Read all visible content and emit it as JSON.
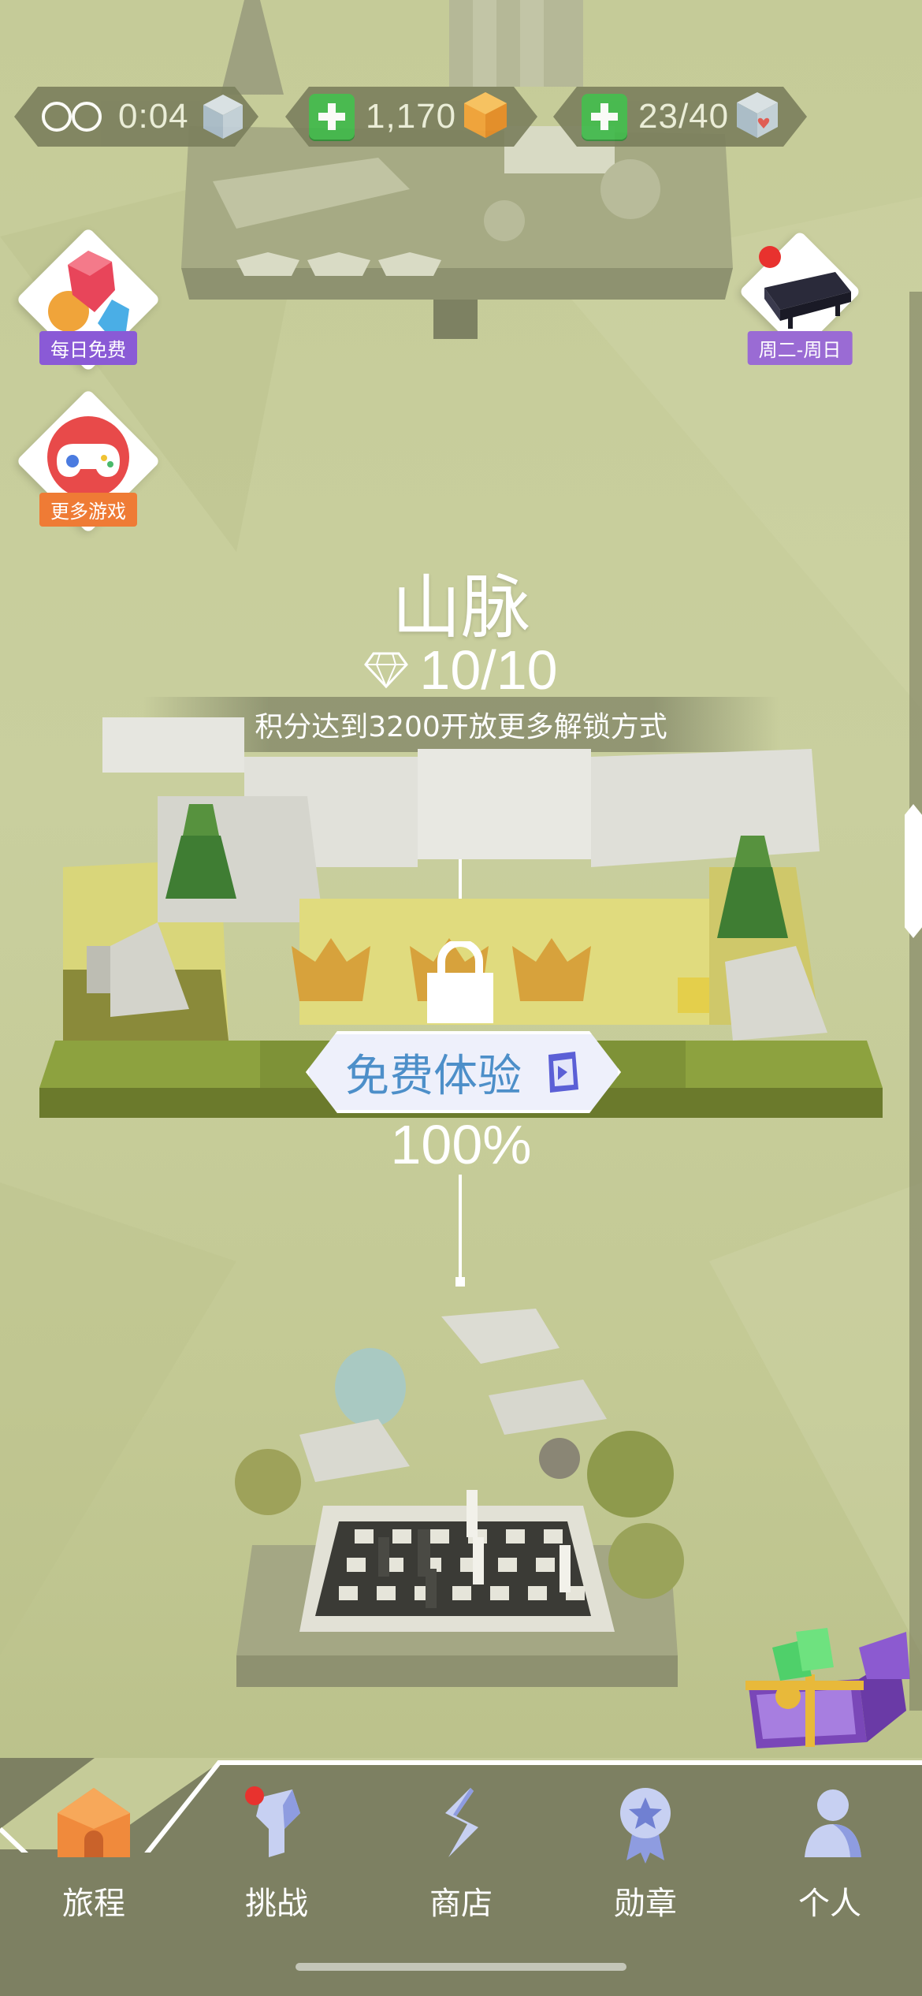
{
  "hud": {
    "timer": "0:04",
    "gems": "1,170",
    "lives": "23/40"
  },
  "side_left": {
    "daily_free_label": "每日免费",
    "more_games_label": "更多游戏"
  },
  "side_right": {
    "weekend_label": "周二-周日"
  },
  "level": {
    "title": "山脉",
    "gem_progress": "10/10",
    "unlock_hint": "积分达到3200开放更多解锁方式",
    "free_trial_label": "免费体验",
    "completion": "100%"
  },
  "nav": {
    "items": [
      {
        "label": "旅程",
        "icon": "home-icon"
      },
      {
        "label": "挑战",
        "icon": "challenge-icon"
      },
      {
        "label": "商店",
        "icon": "shop-icon"
      },
      {
        "label": "勋章",
        "icon": "medal-icon"
      },
      {
        "label": "个人",
        "icon": "profile-icon"
      }
    ]
  },
  "colors": {
    "background": "#c7cd9b",
    "hud_pill": "#7c805e",
    "plus_green": "#3fb94a",
    "daily_badge_purple": "#8a5ad6",
    "more_games_orange": "#ef7b35",
    "free_trial_text": "#4d8fc9",
    "nav_bar": "#7d8062",
    "home_orange": "#f08a3c"
  }
}
